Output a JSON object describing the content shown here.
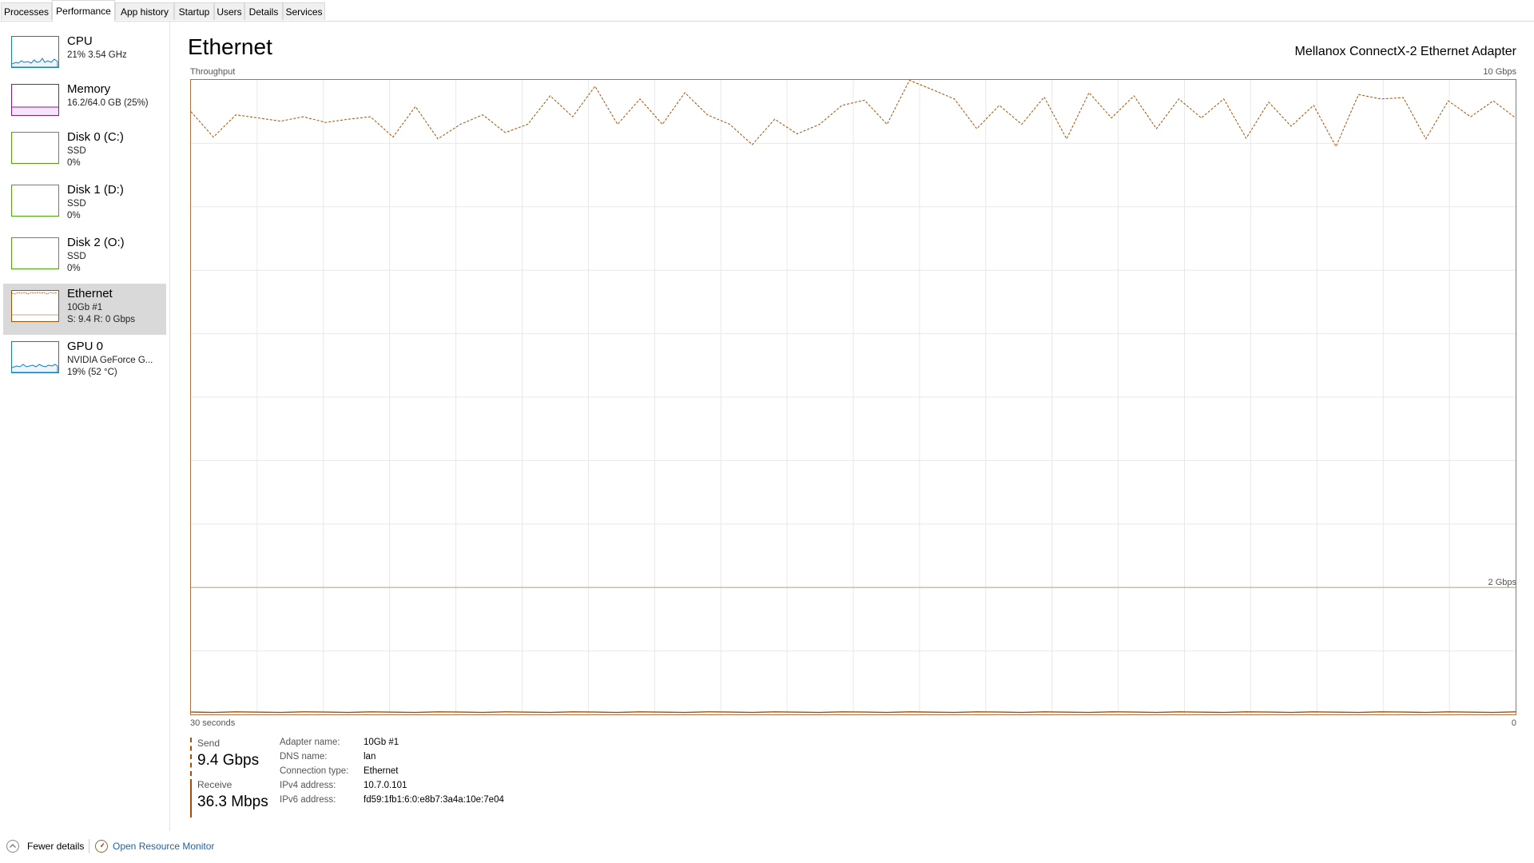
{
  "tabs": [
    "Processes",
    "Performance",
    "App history",
    "Startup",
    "Users",
    "Details",
    "Services"
  ],
  "active_tab": "Performance",
  "sidebar": {
    "items": [
      {
        "title": "CPU",
        "line1": "21%  3.54 GHz",
        "line2": "",
        "line3": "",
        "color": "#117dbb"
      },
      {
        "title": "Memory",
        "line1": "16.2/64.0 GB (25%)",
        "line2": "",
        "line3": "",
        "color": "#8b12ae"
      },
      {
        "title": "Disk 0 (C:)",
        "line1": "SSD",
        "line2": "0%",
        "line3": "",
        "color": "#4da60c"
      },
      {
        "title": "Disk 1 (D:)",
        "line1": "SSD",
        "line2": "0%",
        "line3": "",
        "color": "#4da60c"
      },
      {
        "title": "Disk 2 (O:)",
        "line1": "SSD",
        "line2": "0%",
        "line3": "",
        "color": "#4da60c"
      },
      {
        "title": "Ethernet",
        "line1": "10Gb #1",
        "line2": "S: 9.4  R: 0 Gbps",
        "line3": "",
        "color": "#a74f01"
      },
      {
        "title": "GPU 0",
        "line1": "NVIDIA GeForce G...",
        "line2": "19%  (52 °C)",
        "line3": "",
        "color": "#117dbb"
      }
    ]
  },
  "main": {
    "title": "Ethernet",
    "adapter": "Mellanox ConnectX-2 Ethernet Adapter",
    "throughput_label": "Throughput",
    "max_label": "10 Gbps",
    "mid_label": "2 Gbps",
    "time_label": "30 seconds",
    "zero_label": "0"
  },
  "chart_data": {
    "type": "line",
    "title": "Throughput",
    "y_max_gbps": 10,
    "secondary_scale_label": "2 Gbps",
    "x_range_seconds": 30,
    "series": [
      {
        "name": "Send",
        "color": "#a74f01",
        "dashed": true,
        "values": [
          9.5,
          9.1,
          9.45,
          9.4,
          9.35,
          9.42,
          9.33,
          9.38,
          9.42,
          9.1,
          9.58,
          9.07,
          9.3,
          9.45,
          9.17,
          9.3,
          9.75,
          9.42,
          9.9,
          9.3,
          9.7,
          9.3,
          9.8,
          9.45,
          9.3,
          8.98,
          9.38,
          9.15,
          9.3,
          9.6,
          9.68,
          9.3,
          10.0,
          9.85,
          9.7,
          9.23,
          9.6,
          9.3,
          9.73,
          9.07,
          9.8,
          9.4,
          9.75,
          9.23,
          9.7,
          9.4,
          9.7,
          9.08,
          9.65,
          9.27,
          9.6,
          8.95,
          9.77,
          9.7,
          9.72,
          9.07,
          9.67,
          9.42,
          9.67,
          9.4
        ]
      },
      {
        "name": "Receive",
        "color": "#a74f01",
        "dashed": false,
        "values": [
          0.036,
          0.03,
          0.04,
          0.035,
          0.03,
          0.04,
          0.036,
          0.03,
          0.04,
          0.035,
          0.03,
          0.04,
          0.036,
          0.03,
          0.04,
          0.035,
          0.03,
          0.04,
          0.036,
          0.03,
          0.04,
          0.035,
          0.03,
          0.04,
          0.036,
          0.03,
          0.04,
          0.035,
          0.03,
          0.04,
          0.036,
          0.03,
          0.04,
          0.035,
          0.03,
          0.04,
          0.036,
          0.03,
          0.04,
          0.035,
          0.03,
          0.04,
          0.036,
          0.03,
          0.04,
          0.035,
          0.03,
          0.04,
          0.036,
          0.03,
          0.04,
          0.035,
          0.03,
          0.04,
          0.036,
          0.03,
          0.04,
          0.035,
          0.03,
          0.04
        ]
      }
    ]
  },
  "stats": {
    "send_label": "Send",
    "send_value": "9.4 Gbps",
    "receive_label": "Receive",
    "receive_value": "36.3 Mbps",
    "details": [
      {
        "key": "Adapter name:",
        "value": "10Gb #1"
      },
      {
        "key": "DNS name:",
        "value": "lan"
      },
      {
        "key": "Connection type:",
        "value": "Ethernet"
      },
      {
        "key": "IPv4 address:",
        "value": "10.7.0.101"
      },
      {
        "key": "IPv6 address:",
        "value": "fd59:1fb1:6:0:e8b7:3a4a:10e:7e04"
      }
    ]
  },
  "bottom": {
    "fewer_details": "Fewer details",
    "resource_monitor": "Open Resource Monitor",
    "link_color": "#1e62a8"
  }
}
